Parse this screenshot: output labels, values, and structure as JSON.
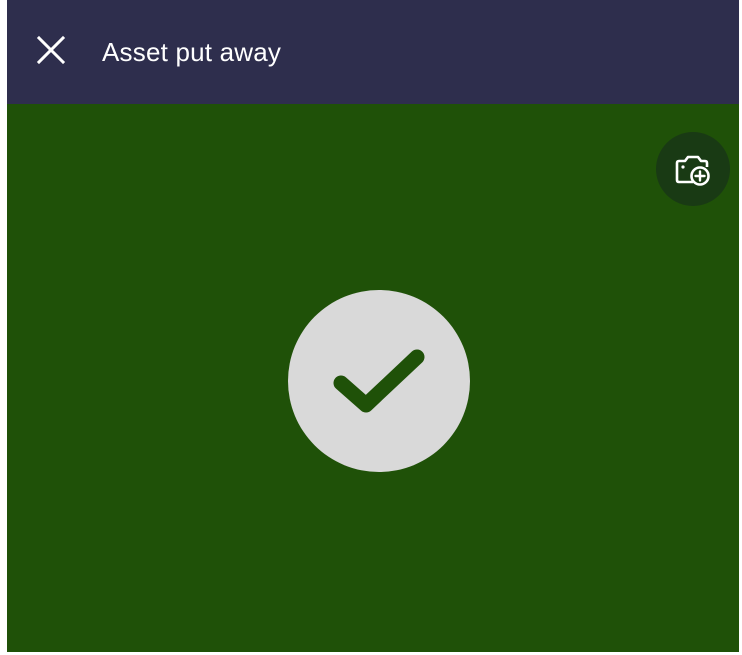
{
  "header": {
    "title": "Asset put away",
    "close_icon": "close-icon"
  },
  "actions": {
    "camera_icon": "add-photo-icon"
  },
  "status": {
    "icon": "check-icon",
    "state": "success"
  },
  "colors": {
    "app_bar": "#2e2e4d",
    "success_background": "#1f5108",
    "camera_button": "#193a14",
    "check_circle": "#d9d9d9",
    "check_mark": "#1f5108"
  }
}
